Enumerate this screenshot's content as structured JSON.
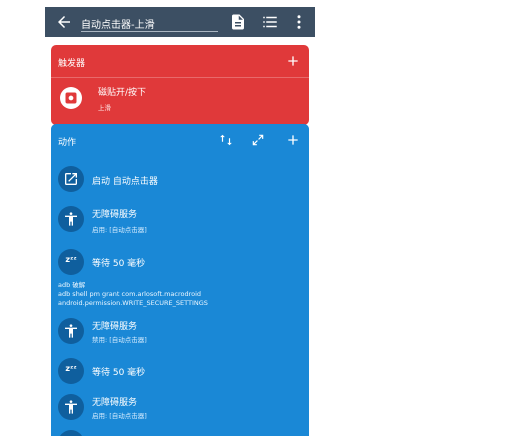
{
  "topbar": {
    "title": "自动点击器-上滑"
  },
  "trigger": {
    "title": "触发器",
    "item_name": "磁贴开/按下",
    "item_sub": "上滑"
  },
  "actions": {
    "title": "动作",
    "items": [
      {
        "name": "启动 自动点击器",
        "sub": ""
      },
      {
        "name": "无障碍服务",
        "sub": "启用: [自动点击器]"
      },
      {
        "name": "等待 50 毫秒",
        "sub": "",
        "glyph": "z"
      },
      {
        "name": "无障碍服务",
        "sub": "禁用: [自动点击器]"
      },
      {
        "name": "等待 50 毫秒",
        "sub": "",
        "glyph": "z"
      },
      {
        "name": "无障碍服务",
        "sub": "启用: [自动点击器]"
      }
    ],
    "adb_comment": {
      "label": "adb 破解",
      "line1": "adb shell pm grant com.arlosoft.macrodroid",
      "line2": "android.permission.WRITE_SECURE_SETTINGS"
    }
  },
  "zz_glyph": "zᶻᶻ"
}
